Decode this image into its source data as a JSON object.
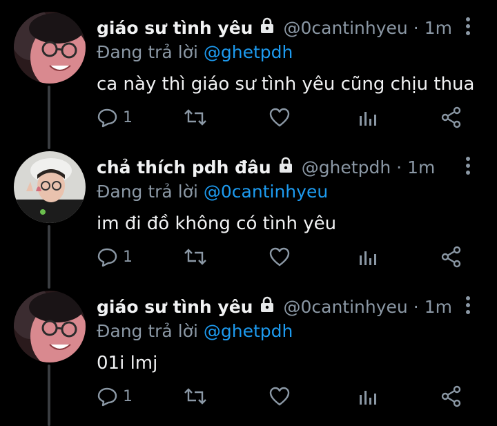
{
  "colors": {
    "background": "#000000",
    "text": "#f1f2f3",
    "muted": "#8b98a5",
    "link": "#1d9bf0",
    "thread_line": "#3a3d41"
  },
  "tweets": [
    {
      "display_name": "giáo sư tình yêu",
      "handle": "@0cantinhyeu",
      "separator": "·",
      "time": "1m",
      "reply_prefix": "Đang trả lời",
      "reply_to": "@ghetpdh",
      "text": "ca này thì giáo sư tình yêu cũng chịu thua",
      "reply_count": "1",
      "locked_icon": "lock-icon",
      "avatar": "avatar-photo-1"
    },
    {
      "display_name": "chả thích pdh đâu",
      "handle": "@ghetpdh",
      "separator": "·",
      "time": "1m",
      "reply_prefix": "Đang trả lời",
      "reply_to": "@0cantinhyeu",
      "text": "im đi đồ không có tình yêu",
      "reply_count": "1",
      "locked_icon": "lock-icon",
      "avatar": "avatar-photo-2"
    },
    {
      "display_name": "giáo sư tình yêu",
      "handle": "@0cantinhyeu",
      "separator": "·",
      "time": "1m",
      "reply_prefix": "Đang trả lời",
      "reply_to": "@ghetpdh",
      "text": "01i lmj",
      "reply_count": "1",
      "locked_icon": "lock-icon",
      "avatar": "avatar-photo-1"
    }
  ]
}
